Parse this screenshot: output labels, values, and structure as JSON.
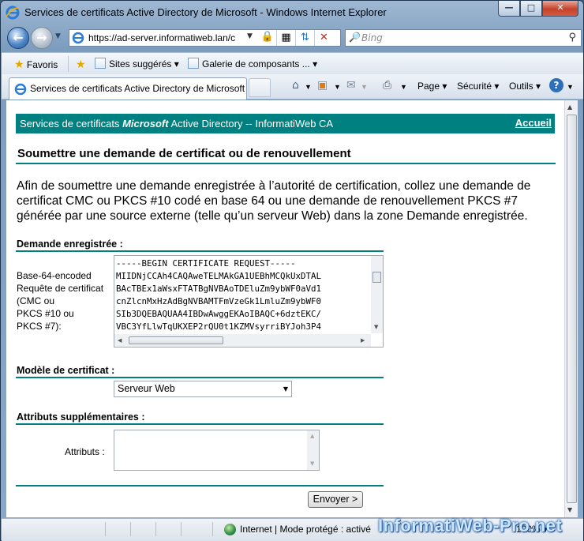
{
  "window": {
    "title": "Services de certificats Active Directory de Microsoft - Windows Internet Explorer",
    "min_label": "—",
    "max_label": "□",
    "close_label": "✕"
  },
  "navigation": {
    "address": "https://ad-server.informatiweb.lan/c",
    "search_placeholder": "Bing"
  },
  "favorites_bar": {
    "favorites": "Favoris",
    "suggested_sites": "Sites suggérés ▾",
    "web_slice_gallery": "Galerie de composants ... ▾"
  },
  "tab": {
    "title": "Services de certificats Active Directory de Microsoft"
  },
  "command_bar": {
    "page": "Page ▾",
    "safety": "Sécurité ▾",
    "tools": "Outils ▾"
  },
  "banner": {
    "prefix": "Services de certificats",
    "brand": "Microsoft",
    "suffix": "Active Directory  --  InformatiWeb CA",
    "home_link": "Accueil"
  },
  "page": {
    "heading": "Soumettre une demande de certificat ou de renouvellement",
    "intro": "Afin de soumettre une demande enregistrée à l’autorité de certification, collez une demande de certificat CMC ou PKCS #10 codé en base 64 ou une demande de renouvellement PKCS #7 générée par une source externe (telle qu’un serveur Web) dans la zone Demande enregistrée."
  },
  "saved_request": {
    "section_title": "Demande enregistrée :",
    "field_label_lines": [
      "Base-64-encoded",
      "Requête de certificat",
      "(CMC ou",
      "PKCS #10 ou",
      "PKCS #7):"
    ],
    "content_lines": [
      "-----BEGIN CERTIFICATE REQUEST-----",
      "MIIDNjCCAh4CAQAweTELMAkGA1UEBhMCQkUxDTAL",
      "BAcTBEx1aWsxFTATBgNVBAoTDEluZm9ybWF0aVd1",
      "cnZlcnMxHzAdBgNVBAMTFmVzeGk1LmluZm9ybWF0",
      "SIb3DQEBAQUAA4IBDwAwggEKAoIBAQC+6dztEKC/",
      "VBC3YfLlwTqUKXEP2rQU0t1KZMVsyrriBYJoh3P4"
    ]
  },
  "template": {
    "section_title": "Modèle de certificat :",
    "selected": "Serveur Web"
  },
  "attributes": {
    "section_title": "Attributs supplémentaires :",
    "field_label": "Attributs :",
    "value": ""
  },
  "submit_label": "Envoyer >",
  "status_bar": {
    "zone": "Internet | Mode protégé : activé",
    "zoom": "100% ▾"
  },
  "watermark": "InformatiWeb-Pro.net",
  "colors": {
    "accent": "#008080"
  }
}
